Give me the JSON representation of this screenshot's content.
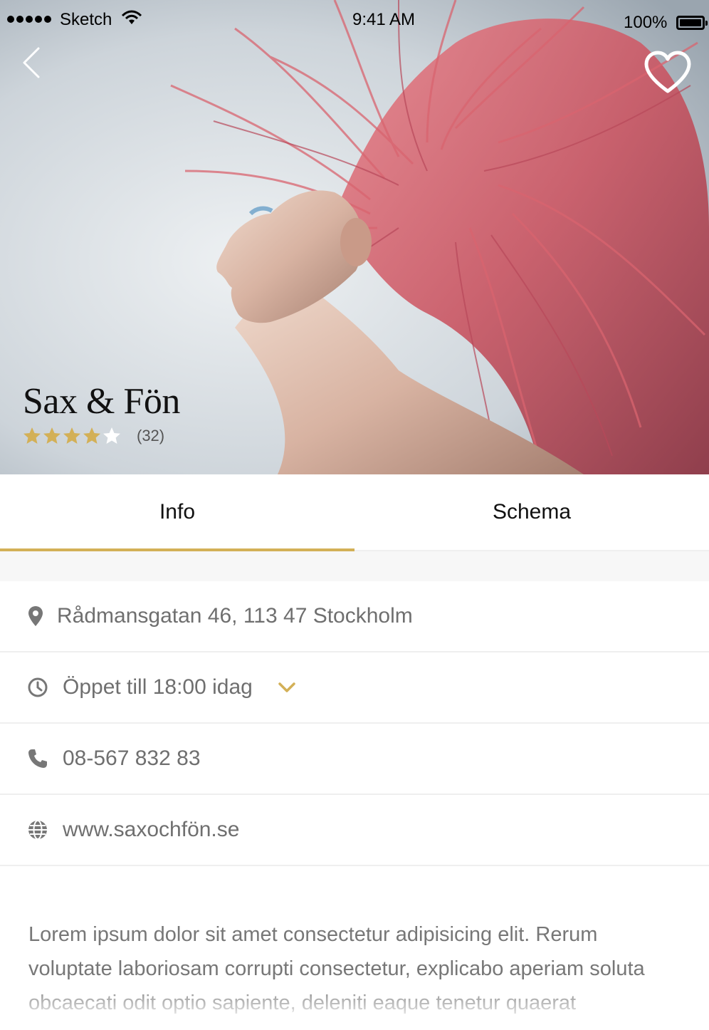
{
  "status_bar": {
    "carrier": "Sketch",
    "time": "9:41 AM",
    "battery": "100%"
  },
  "salon": {
    "name": "Sax & Fön",
    "rating": 4,
    "rating_max": 5,
    "review_count": "(32)"
  },
  "tabs": [
    {
      "label": "Info",
      "active": true
    },
    {
      "label": "Schema",
      "active": false
    }
  ],
  "info": {
    "address": "Rådmansgatan 46, 113 47 Stockholm",
    "hours": "Öppet till 18:00 idag",
    "phone": "08-567 832 83",
    "website": "www.saxochfön.se"
  },
  "description": "Lorem ipsum dolor sit amet consectetur adipisicing elit. Rerum voluptate laboriosam corrupti consectetur, explicabo aperiam soluta obcaecati odit optio sapiente, deleniti eaque tenetur quaerat",
  "colors": {
    "accent": "#d3b057",
    "hair": "#d6656f",
    "text_muted": "#6f6f6f"
  },
  "icons": [
    "wifi-icon",
    "battery-icon",
    "back-arrow-icon",
    "heart-icon",
    "star-icon",
    "location-pin-icon",
    "clock-icon",
    "chevron-down-icon",
    "phone-icon",
    "globe-icon"
  ]
}
